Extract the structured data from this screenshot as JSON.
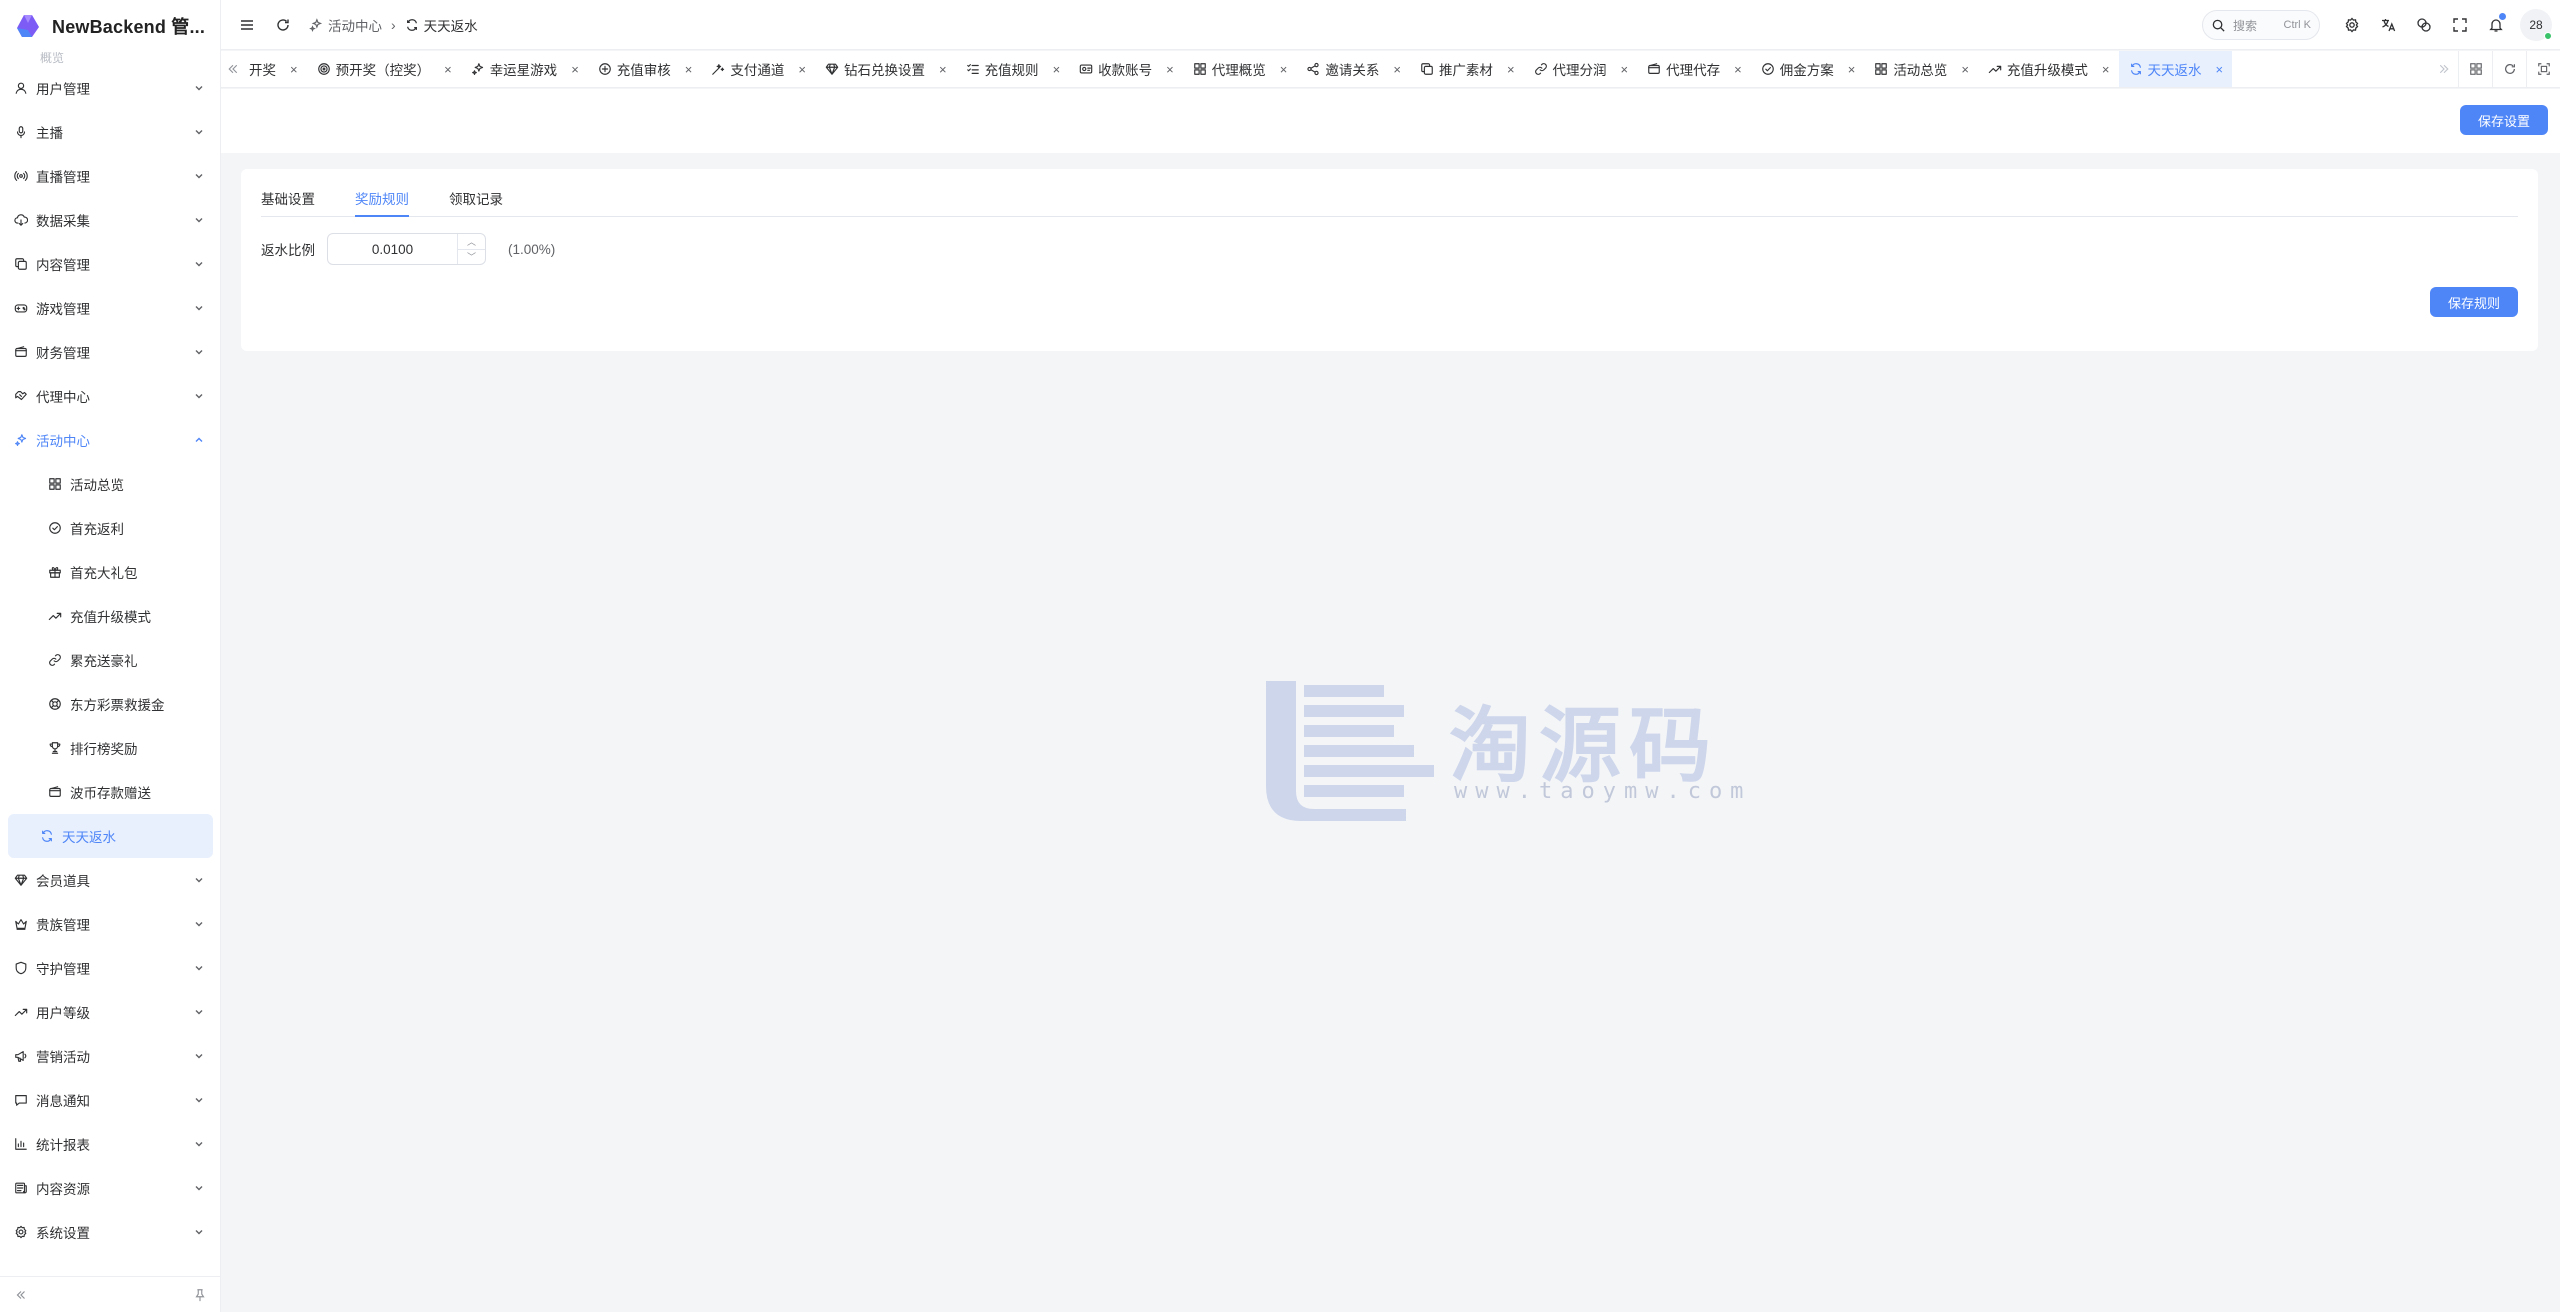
{
  "app": {
    "title": "NewBackend 管...",
    "brand_color": "#4f86f7"
  },
  "sidebar": {
    "ghost_item": "概览",
    "items": [
      {
        "label": "用户管理",
        "icon": "user-icon",
        "name": "users"
      },
      {
        "label": "主播",
        "icon": "microphone-icon",
        "name": "anchor"
      },
      {
        "label": "直播管理",
        "icon": "broadcast-icon",
        "name": "live"
      },
      {
        "label": "数据采集",
        "icon": "cloud-download-icon",
        "name": "data-collect"
      },
      {
        "label": "内容管理",
        "icon": "copy-icon",
        "name": "content"
      },
      {
        "label": "游戏管理",
        "icon": "gamepad-icon",
        "name": "games"
      },
      {
        "label": "财务管理",
        "icon": "wallet-icon",
        "name": "finance"
      },
      {
        "label": "代理中心",
        "icon": "handshake-icon",
        "name": "agent"
      },
      {
        "label": "活动中心",
        "icon": "sparkles-icon",
        "name": "activity"
      }
    ],
    "sub_items": [
      {
        "label": "活动总览",
        "icon": "grid-icon",
        "name": "activity-overview"
      },
      {
        "label": "首充返利",
        "icon": "check-circle-icon",
        "name": "first-recharge-rebate"
      },
      {
        "label": "首充大礼包",
        "icon": "gift-icon",
        "name": "first-recharge-gift"
      },
      {
        "label": "充值升级模式",
        "icon": "trending-up-icon",
        "name": "recharge-upgrade"
      },
      {
        "label": "累充送豪礼",
        "icon": "link-icon",
        "name": "cumulative-recharge"
      },
      {
        "label": "东方彩票救援金",
        "icon": "lifebuoy-icon",
        "name": "lottery-rescue"
      },
      {
        "label": "排行榜奖励",
        "icon": "trophy-icon",
        "name": "leaderboard-reward"
      },
      {
        "label": "波币存款赠送",
        "icon": "wallet-icon",
        "name": "coin-deposit-bonus"
      },
      {
        "label": "天天返水",
        "icon": "refresh-icon",
        "name": "daily-rebate"
      }
    ],
    "items_after": [
      {
        "label": "会员道具",
        "icon": "diamond-icon",
        "name": "member-props"
      },
      {
        "label": "贵族管理",
        "icon": "crown-icon",
        "name": "nobility"
      },
      {
        "label": "守护管理",
        "icon": "shield-icon",
        "name": "guard"
      },
      {
        "label": "用户等级",
        "icon": "trending-up-icon",
        "name": "user-level"
      },
      {
        "label": "营销活动",
        "icon": "megaphone-icon",
        "name": "marketing"
      },
      {
        "label": "消息通知",
        "icon": "message-icon",
        "name": "messages"
      },
      {
        "label": "统计报表",
        "icon": "bar-chart-icon",
        "name": "statistics"
      },
      {
        "label": "内容资源",
        "icon": "newspaper-icon",
        "name": "content-resources"
      },
      {
        "label": "系统设置",
        "icon": "gear-icon",
        "name": "system-settings"
      }
    ]
  },
  "header": {
    "breadcrumb": [
      {
        "label": "活动中心",
        "icon": "sparkles-icon"
      },
      {
        "label": "天天返水",
        "icon": "refresh-icon"
      }
    ],
    "search_placeholder": "搜索",
    "search_shortcut": "Ctrl K",
    "avatar_text": "28"
  },
  "tabs": [
    {
      "label": "开奖",
      "icon": ""
    },
    {
      "label": "预开奖（控奖）",
      "icon": "target-icon"
    },
    {
      "label": "幸运星游戏",
      "icon": "sparkles-icon"
    },
    {
      "label": "充值审核",
      "icon": "plus-circle-icon"
    },
    {
      "label": "支付通道",
      "icon": "magic-wand-icon"
    },
    {
      "label": "钻石兑换设置",
      "icon": "diamond-icon"
    },
    {
      "label": "充值规则",
      "icon": "list-check-icon"
    },
    {
      "label": "收款账号",
      "icon": "card-icon"
    },
    {
      "label": "代理概览",
      "icon": "grid-icon"
    },
    {
      "label": "邀请关系",
      "icon": "share-icon"
    },
    {
      "label": "推广素材",
      "icon": "copy-icon"
    },
    {
      "label": "代理分润",
      "icon": "link-icon"
    },
    {
      "label": "代理代存",
      "icon": "wallet-icon"
    },
    {
      "label": "佣金方案",
      "icon": "check-circle-icon"
    },
    {
      "label": "活动总览",
      "icon": "grid-icon"
    },
    {
      "label": "充值升级模式",
      "icon": "trending-up-icon"
    },
    {
      "label": "天天返水",
      "icon": "refresh-icon"
    }
  ],
  "active_tab": "天天返水",
  "page": {
    "save_settings_label": "保存设置",
    "inner_tabs": [
      "基础设置",
      "奖励规则",
      "领取记录"
    ],
    "active_inner_tab": "奖励规则",
    "rebate_label": "返水比例",
    "rebate_value": "0.0100",
    "rebate_percent_hint": "(1.00%)",
    "save_rule_label": "保存规则"
  },
  "watermark": {
    "text": "淘源码",
    "url": "www.taoymw.com"
  }
}
